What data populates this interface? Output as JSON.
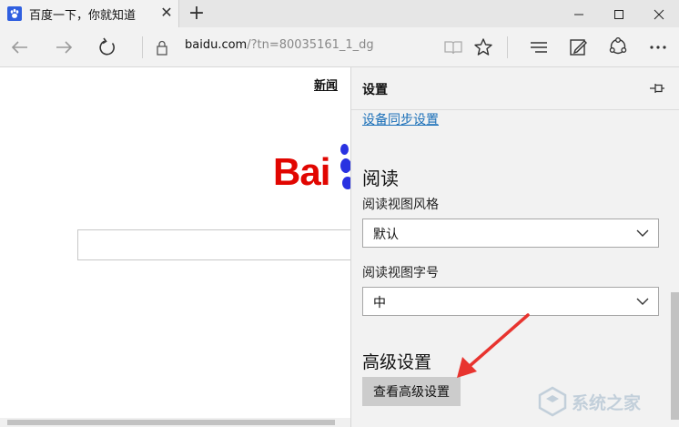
{
  "tab": {
    "title": "百度一下，你就知道",
    "close": "✕",
    "new_tab": "+"
  },
  "window_controls": {
    "minimize": "—",
    "maximize": "☐",
    "close": "✕"
  },
  "address": {
    "host": "baidu.com",
    "path": "/?tn=80035161_1_dg"
  },
  "page": {
    "news_link": "新闻",
    "logo_text": "Bai"
  },
  "settings": {
    "title": "设置",
    "sync_link": "设备同步设置",
    "reading_heading": "阅读",
    "reading_style_label": "阅读视图风格",
    "reading_style_value": "默认",
    "reading_font_label": "阅读视图字号",
    "reading_font_value": "中",
    "advanced_heading": "高级设置",
    "advanced_button": "查看高级设置"
  },
  "watermark": "系统之家",
  "colors": {
    "accent_link": "#1a6fb8",
    "baidu_red": "#e10601",
    "baidu_blue": "#2932e1",
    "annotation_arrow": "#e8342f"
  },
  "icons": [
    "baidu-paw-icon",
    "back-icon",
    "forward-icon",
    "refresh-icon",
    "lock-icon",
    "reading-view-icon",
    "favorite-star-icon",
    "hub-icon",
    "web-note-icon",
    "share-icon",
    "more-icon",
    "pin-icon",
    "chevron-down-icon"
  ]
}
